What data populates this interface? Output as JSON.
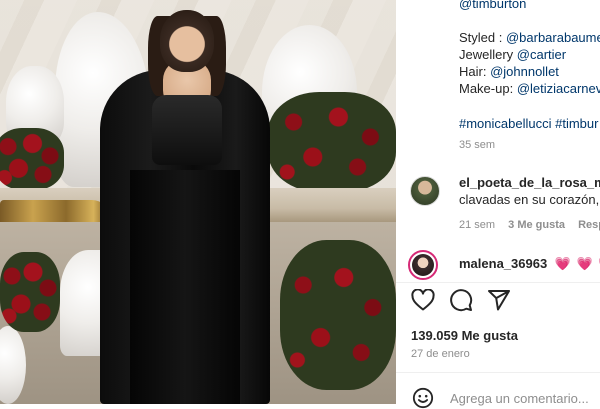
{
  "post": {
    "caption": {
      "top_mention": "@timburton",
      "styled_label": "Styled : ",
      "styled_mention": "@barbarabaume",
      "jewellery_label": "Jewellery ",
      "jewellery_mention": "@cartier",
      "hair_label": "Hair: ",
      "hair_mention": "@johnnollet",
      "makeup_label": "Make-up: ",
      "makeup_mention": "@letiziacarnev",
      "hashtags": "#monicabellucci #timbur",
      "age": "35 sem"
    },
    "comments": [
      {
        "username": "el_poeta_de_la_rosa_mu",
        "text": "clavadas en su corazón,",
        "age": "21 sem",
        "likes": "3 Me gusta",
        "reply": "Resp"
      },
      {
        "username": "malena_36963",
        "text": "💗 💗 💗"
      }
    ],
    "likes_count": "139.059 Me gusta",
    "date": "27 de enero"
  },
  "composer": {
    "placeholder": "Agrega un comentario..."
  },
  "icons": {
    "like": "heart-icon",
    "comment": "comment-icon",
    "share": "share-icon",
    "emoji": "emoji-icon"
  }
}
